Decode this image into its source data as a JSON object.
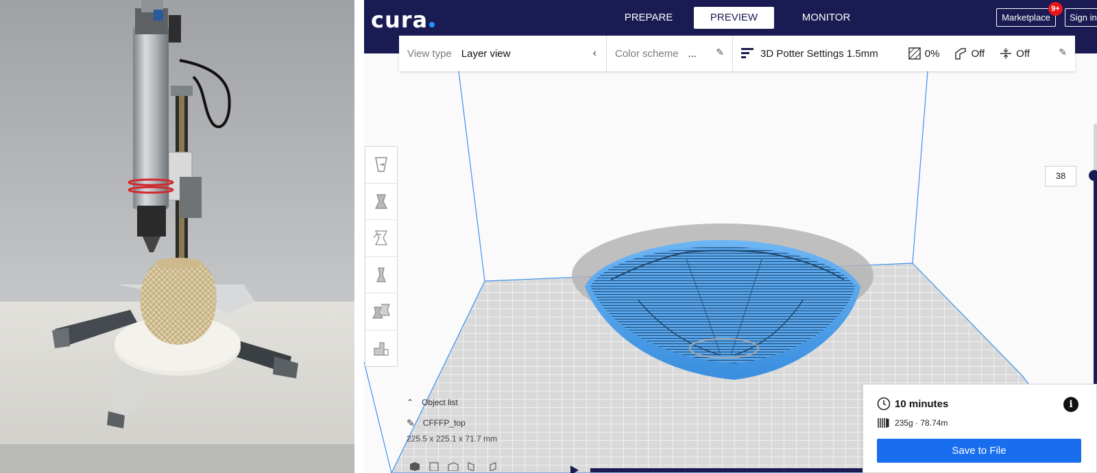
{
  "app": {
    "logo": "cura",
    "colors": {
      "header": "#1a1b52",
      "accent": "#196ef0",
      "model": "#5aa8ee",
      "badge": "#e8161b"
    }
  },
  "header": {
    "tabs": [
      {
        "label": "PREPARE",
        "active": false
      },
      {
        "label": "PREVIEW",
        "active": true
      },
      {
        "label": "MONITOR",
        "active": false
      }
    ],
    "marketplace_label": "Marketplace",
    "marketplace_badge": "9+",
    "signin_label": "Sign in"
  },
  "settings_bar": {
    "view_type_label": "View type",
    "view_type_value": "Layer view",
    "color_scheme_label": "Color scheme",
    "color_scheme_value": "...",
    "printer_profile": "3D Potter Settings 1.5mm",
    "infill_value": "0%",
    "support_value": "Off",
    "adhesion_value": "Off"
  },
  "toolbar": {
    "tools": [
      "move-tool",
      "scale-tool",
      "rotate-tool",
      "mirror-tool",
      "per-model-settings-tool",
      "support-blocker-tool"
    ]
  },
  "layer_slider": {
    "current_layer": "38"
  },
  "object_list": {
    "toggle_label": "Object list",
    "object_name": "CFFFP_top",
    "dimensions": "225.5 x 225.1 x 71.7 mm"
  },
  "print_info": {
    "time": "10 minutes",
    "material": "235g · 78.74m",
    "save_label": "Save to File",
    "info_symbol": "i"
  }
}
